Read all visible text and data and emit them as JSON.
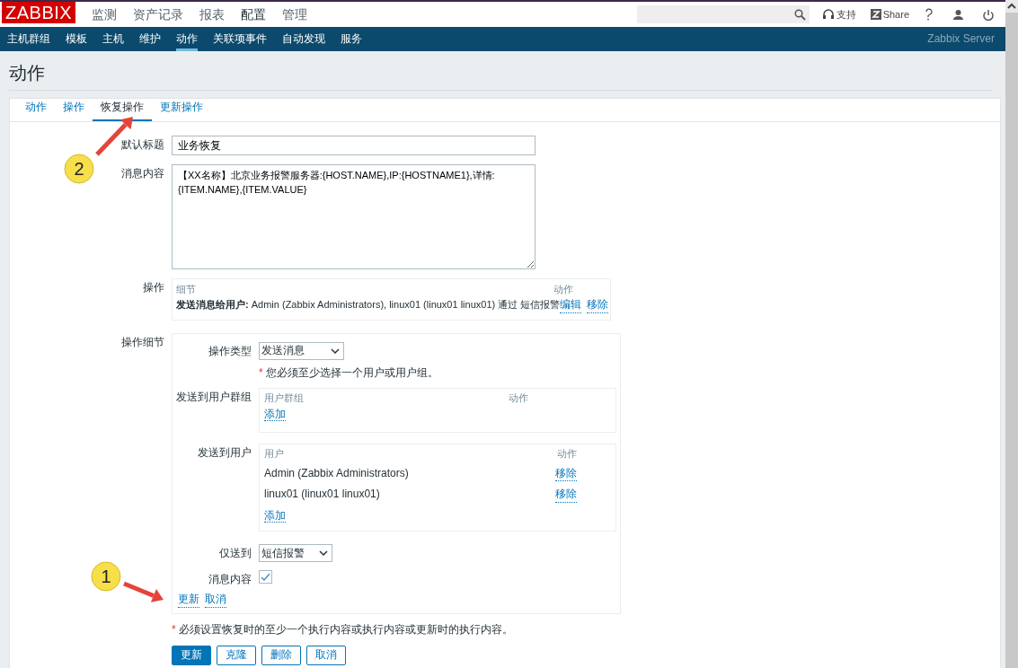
{
  "header": {
    "logo": "ZABBIX",
    "menu": [
      {
        "label": "监测",
        "selected": false
      },
      {
        "label": "资产记录",
        "selected": false
      },
      {
        "label": "报表",
        "selected": false
      },
      {
        "label": "配置",
        "selected": true
      },
      {
        "label": "管理",
        "selected": false
      }
    ],
    "support": "支持",
    "share": "Share"
  },
  "subnav": {
    "items": [
      {
        "label": "主机群组",
        "selected": false
      },
      {
        "label": "模板",
        "selected": false
      },
      {
        "label": "主机",
        "selected": false
      },
      {
        "label": "维护",
        "selected": false
      },
      {
        "label": "动作",
        "selected": true
      },
      {
        "label": "关联项事件",
        "selected": false
      },
      {
        "label": "自动发现",
        "selected": false
      },
      {
        "label": "服务",
        "selected": false
      }
    ],
    "server": "Zabbix Server"
  },
  "page_title": "动作",
  "tabs": [
    {
      "label": "动作",
      "selected": false
    },
    {
      "label": "操作",
      "selected": false
    },
    {
      "label": "恢复操作",
      "selected": true
    },
    {
      "label": "更新操作",
      "selected": false
    }
  ],
  "form": {
    "default_subject": {
      "label": "默认标题",
      "value": "业务恢复"
    },
    "message": {
      "label": "消息内容",
      "value": "【XX名称】北京业务报警服务器:{HOST.NAME},IP:{HOSTNAME1},详情:\n{ITEM.NAME},{ITEM.VALUE}"
    },
    "operations": {
      "label": "操作",
      "columns": [
        "细节",
        "动作"
      ],
      "rows": [
        {
          "detail": "**发送消息给用户:** Admin (Zabbix Administrators), linux01 (linux01 linux01) 通过 短信报警",
          "actions": [
            "编辑",
            "移除"
          ]
        }
      ]
    },
    "operation_details": {
      "label": "操作细节",
      "type": {
        "label": "操作类型",
        "value": "发送消息"
      },
      "required_mark": "*",
      "required_note": "您必须至少选择一个用户或用户组。",
      "user_groups": {
        "label": "发送到用户群组",
        "columns": [
          "用户群组",
          "动作"
        ],
        "add": "添加"
      },
      "users": {
        "label": "发送到用户",
        "columns": [
          "用户",
          "动作"
        ],
        "rows": [
          {
            "name": "Admin (Zabbix Administrators)",
            "action": "移除"
          },
          {
            "name": "linux01 (linux01 linux01)",
            "action": "移除"
          }
        ],
        "add": "添加"
      },
      "send_only": {
        "label": "仅送到",
        "value": "短信报警"
      },
      "message_content": {
        "label": "消息内容",
        "checked": true
      },
      "links": [
        "更新",
        "取消"
      ]
    },
    "footer_mark": "*",
    "footer_note": "必须设置恢复时的至少一个执行内容或执行内容或更新时的执行内容。",
    "buttons": [
      {
        "label": "更新",
        "kind": "primary"
      },
      {
        "label": "克隆",
        "kind": "secondary"
      },
      {
        "label": "删除",
        "kind": "secondary"
      },
      {
        "label": "取消",
        "kind": "secondary"
      }
    ]
  },
  "annotations": [
    {
      "label": "1"
    },
    {
      "label": "2"
    }
  ]
}
